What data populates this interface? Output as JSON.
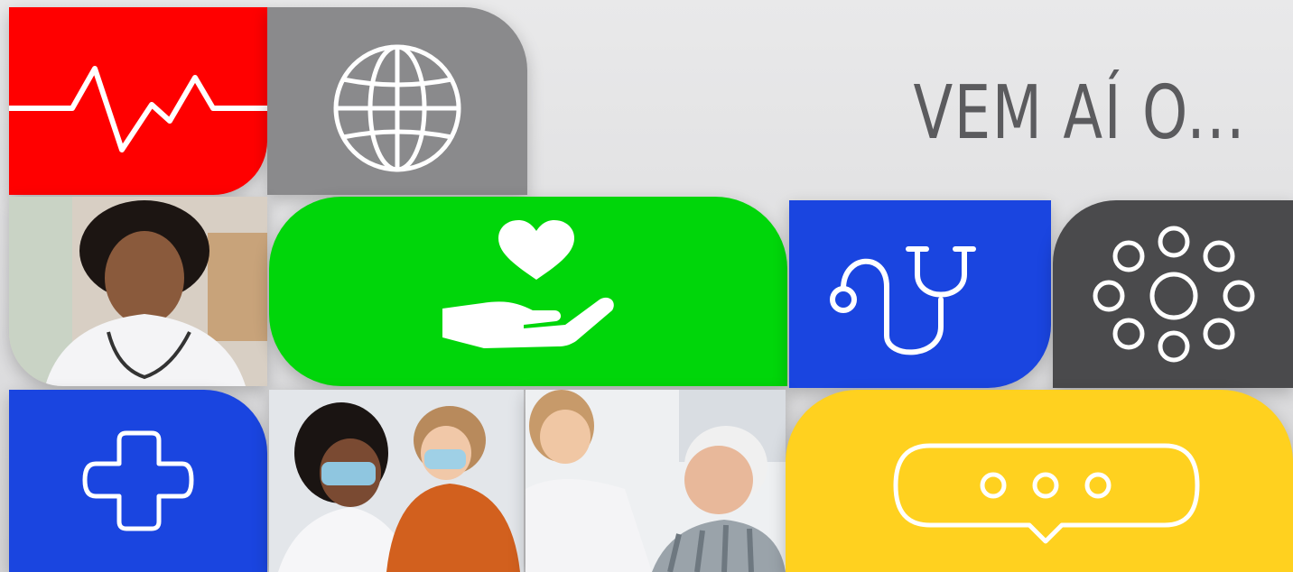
{
  "headline": "VEM AÍ O...",
  "colors": {
    "red": "#ff0000",
    "gray_light": "#8a8a8c",
    "green": "#00d60a",
    "blue": "#1a45e0",
    "dark_gray": "#4a4a4c",
    "yellow": "#ffd11f",
    "icon_stroke": "#ffffff"
  },
  "tiles": [
    {
      "name": "heartbeat-tile",
      "icon": "heartbeat-icon",
      "color": "red"
    },
    {
      "name": "globe-tile",
      "icon": "globe-icon",
      "color": "gray_light"
    },
    {
      "name": "care-tile",
      "icon": "heart-hand-icon",
      "color": "green"
    },
    {
      "name": "stethoscope-tile",
      "icon": "stethoscope-icon",
      "color": "blue"
    },
    {
      "name": "network-tile",
      "icon": "circles-network-icon",
      "color": "dark_gray"
    },
    {
      "name": "health-cross-tile",
      "icon": "plus-cross-icon",
      "color": "blue"
    },
    {
      "name": "chat-tile",
      "icon": "speech-bubble-icon",
      "color": "yellow"
    }
  ],
  "photos": [
    {
      "name": "photo-doctor-smiling"
    },
    {
      "name": "photo-doctor-with-child"
    },
    {
      "name": "photo-nurse-with-elderly-man"
    }
  ]
}
